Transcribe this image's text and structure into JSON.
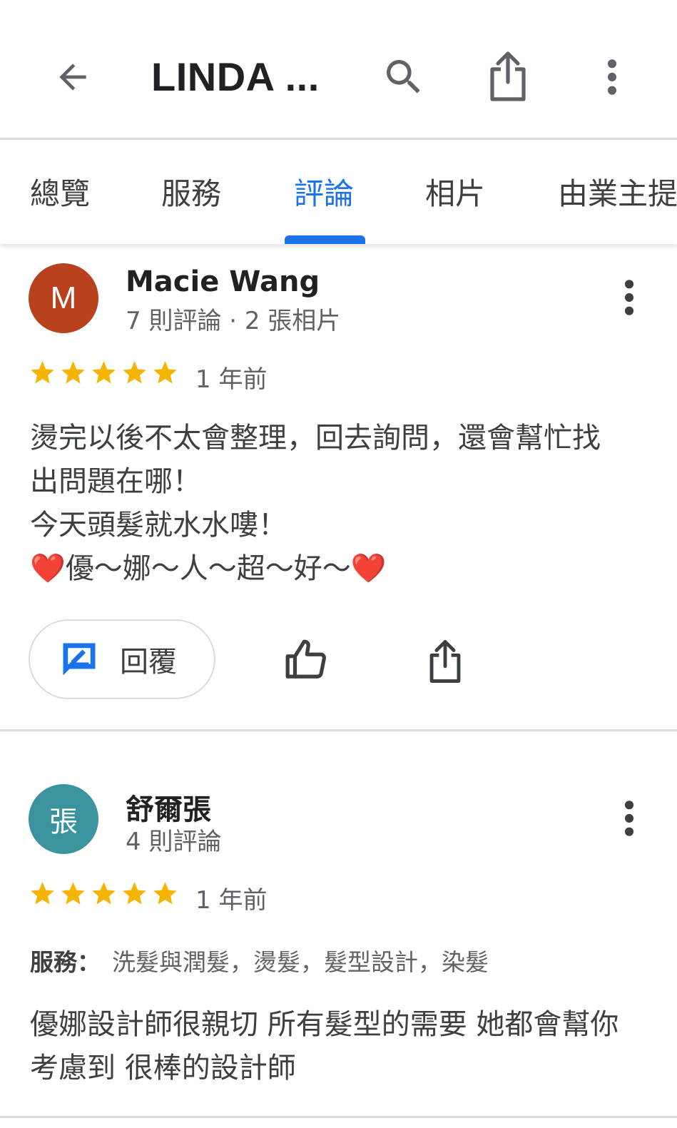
{
  "appbar": {
    "title": "LINDA ...",
    "icons": [
      "back-arrow-icon",
      "search-icon",
      "share-icon",
      "more-vert-icon"
    ]
  },
  "tabs": [
    {
      "label": "總覽",
      "active": false
    },
    {
      "label": "服務",
      "active": false
    },
    {
      "label": "評論",
      "active": true
    },
    {
      "label": "相片",
      "active": false
    },
    {
      "label": "由業主提",
      "active": false
    }
  ],
  "colors": {
    "accent": "#1a73e8",
    "star": "#f4b400",
    "avatar_m": "#b8411e",
    "avatar_zhang": "#3a939d"
  },
  "reviews": [
    {
      "avatar_letter": "M",
      "name": "Macie Wang",
      "meta": "7 則評論 · 2 張相片",
      "rating": 5,
      "time": "1 年前",
      "lines": [
        "燙完以後不太會整理，回去詢問，還會幫忙找",
        "出問題在哪！",
        "今天頭髮就水水嘍！"
      ],
      "emoji_line": {
        "heart": "❤️",
        "text": "優～娜～人～超～好～"
      },
      "reply_label": "回覆"
    },
    {
      "avatar_letter": "張",
      "name": "舒爾張",
      "meta": "4 則評論",
      "rating": 5,
      "time": "1 年前",
      "service_label": "服務：",
      "service_value": "洗髮與潤髮，燙髮，髮型設計，染髮",
      "lines": [
        "優娜設計師很親切 所有髮型的需要 她都會幫你",
        "考慮到 很棒的設計師"
      ]
    }
  ]
}
